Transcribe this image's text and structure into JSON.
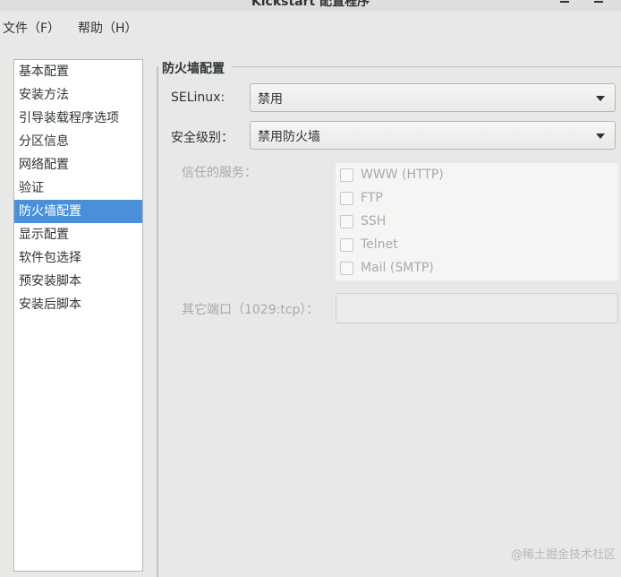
{
  "window": {
    "title": "Kickstart 配置程序"
  },
  "menu": [
    {
      "label": "文件（F）"
    },
    {
      "label": "帮助（H）"
    }
  ],
  "sidebar": {
    "items": [
      {
        "label": "基本配置"
      },
      {
        "label": "安装方法"
      },
      {
        "label": "引导装载程序选项"
      },
      {
        "label": "分区信息"
      },
      {
        "label": "网络配置"
      },
      {
        "label": "验证"
      },
      {
        "label": "防火墙配置",
        "selected": true
      },
      {
        "label": "显示配置"
      },
      {
        "label": "软件包选择"
      },
      {
        "label": "预安装脚本"
      },
      {
        "label": "安装后脚本"
      }
    ]
  },
  "panel": {
    "title": "防火墙配置",
    "selinux": {
      "label": "SELinux:",
      "value": "禁用"
    },
    "security_level": {
      "label": "安全级别：",
      "value": "禁用防火墙"
    },
    "trusted": {
      "label": "信任的服务：",
      "services": [
        {
          "label": "WWW (HTTP)",
          "checked": false
        },
        {
          "label": "FTP",
          "checked": false
        },
        {
          "label": "SSH",
          "checked": false
        },
        {
          "label": "Telnet",
          "checked": false
        },
        {
          "label": "Mail (SMTP)",
          "checked": false
        }
      ]
    },
    "other_ports": {
      "label": "其它端口（1029:tcp）：",
      "value": ""
    }
  },
  "watermark": "@稀土掘金技术社区"
}
